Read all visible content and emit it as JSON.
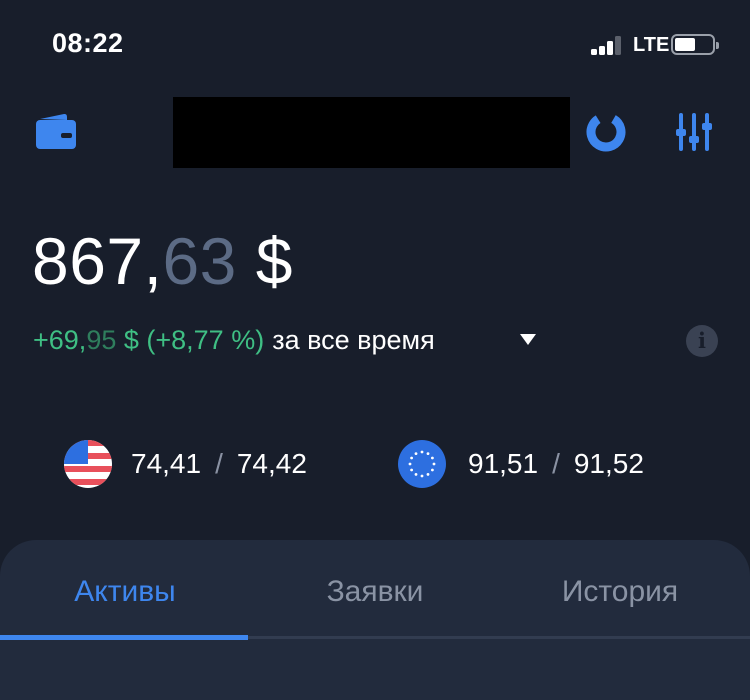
{
  "status_bar": {
    "time": "08:22",
    "network": "LTE"
  },
  "header": {
    "wallet_icon": "wallet-icon",
    "donut_icon": "donut-chart-icon",
    "filter_icon": "sliders-icon",
    "accent_color": "#3e86ee"
  },
  "balance": {
    "integer": "867,",
    "cents": "63",
    "currency": " $"
  },
  "change": {
    "main": "+69,",
    "cents": "95",
    "rest": " $ (+8,77 %)",
    "period": "за все время"
  },
  "rates": {
    "usd": {
      "flag": "us-flag-icon",
      "buy": "74,41",
      "separator": "/",
      "sell": "74,42"
    },
    "eur": {
      "flag": "eu-flag-icon",
      "buy": "91,51",
      "separator": "/",
      "sell": "91,52"
    }
  },
  "tabs": [
    {
      "label": "Активы",
      "active": true
    },
    {
      "label": "Заявки",
      "active": false
    },
    {
      "label": "История",
      "active": false
    }
  ]
}
